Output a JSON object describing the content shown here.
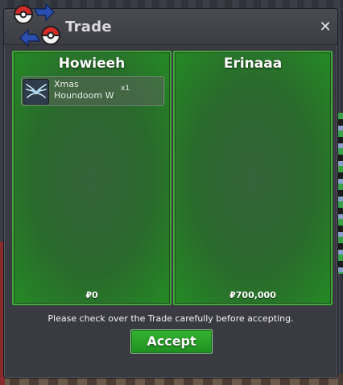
{
  "window": {
    "title": "Trade",
    "close_label": "✕"
  },
  "trade": {
    "left": {
      "trader": "Howieeh",
      "items": [
        {
          "name": "Xmas Houndoom W",
          "quantity": "x1",
          "icon": "wings-icon"
        }
      ],
      "money": "₽0"
    },
    "right": {
      "trader": "Erinaaa",
      "items": [],
      "money": "₽700,000"
    }
  },
  "notice": "Please check over the Trade carefully before accepting.",
  "buttons": {
    "accept": "Accept"
  },
  "colors": {
    "panel_green": "#2a6a2c",
    "panel_border": "#42a83a",
    "accept_green": "#2aa32a",
    "window_bg": "#3a3a42"
  }
}
